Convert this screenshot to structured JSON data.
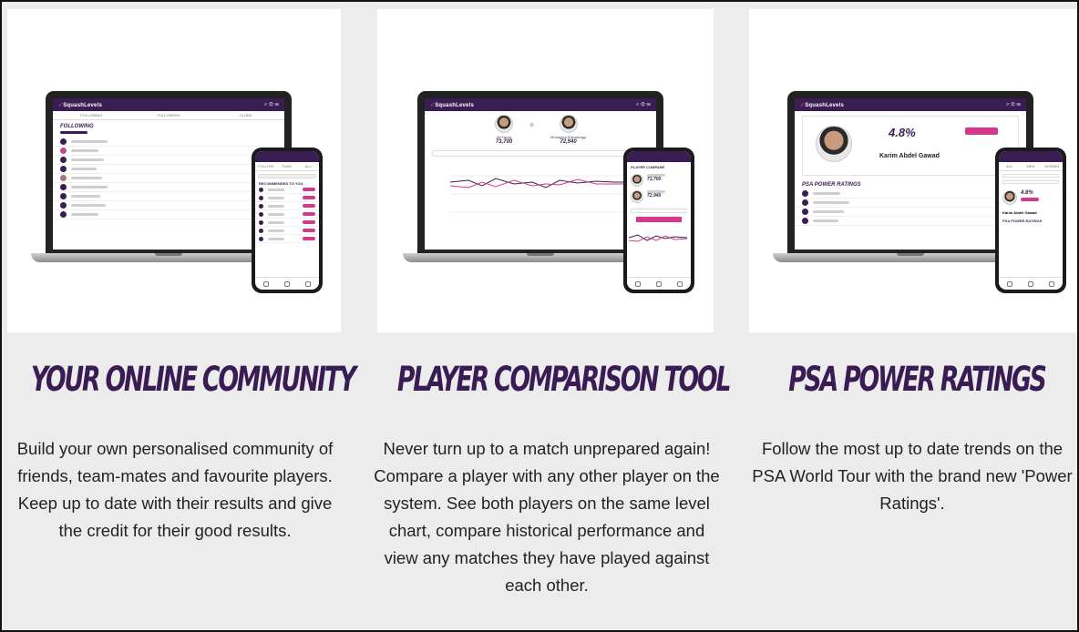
{
  "features": [
    {
      "title": "YOUR ONLINE COMMUNITY",
      "description": "Build your own personalised community of friends, team-mates and favourite players. Keep up to date with their results and give the credit for their good results.",
      "laptop_heading": "FOLLOWING",
      "phone_heading": "RECOMMENDED TO YOU"
    },
    {
      "title": "PLAYER COMPARISON TOOL",
      "description": "Never turn up to a match unprepared again! Compare a player with any other player on the system. See both players on the same level chart, compare historical performance and view any matches they have played against each other.",
      "player_a": "Ali Farag",
      "player_a_score": "73,700",
      "player_b": "Mohamed Elshorbagy",
      "player_b_score": "72,940",
      "phone_heading": "PLAYER COMPARE"
    },
    {
      "title": "PSA POWER RATINGS",
      "description": "Follow the most up to date trends on the PSA World Tour with the brand new 'Power Ratings'.",
      "rating_value": "4.8%",
      "featured_player": "Karim Abdel Gawad",
      "list_heading": "PSA POWER RATINGS"
    }
  ],
  "app_name": "SquashLevels",
  "colors": {
    "brand_purple": "#3a1c55",
    "accent_pink": "#d33a8b",
    "background": "#ececec"
  }
}
